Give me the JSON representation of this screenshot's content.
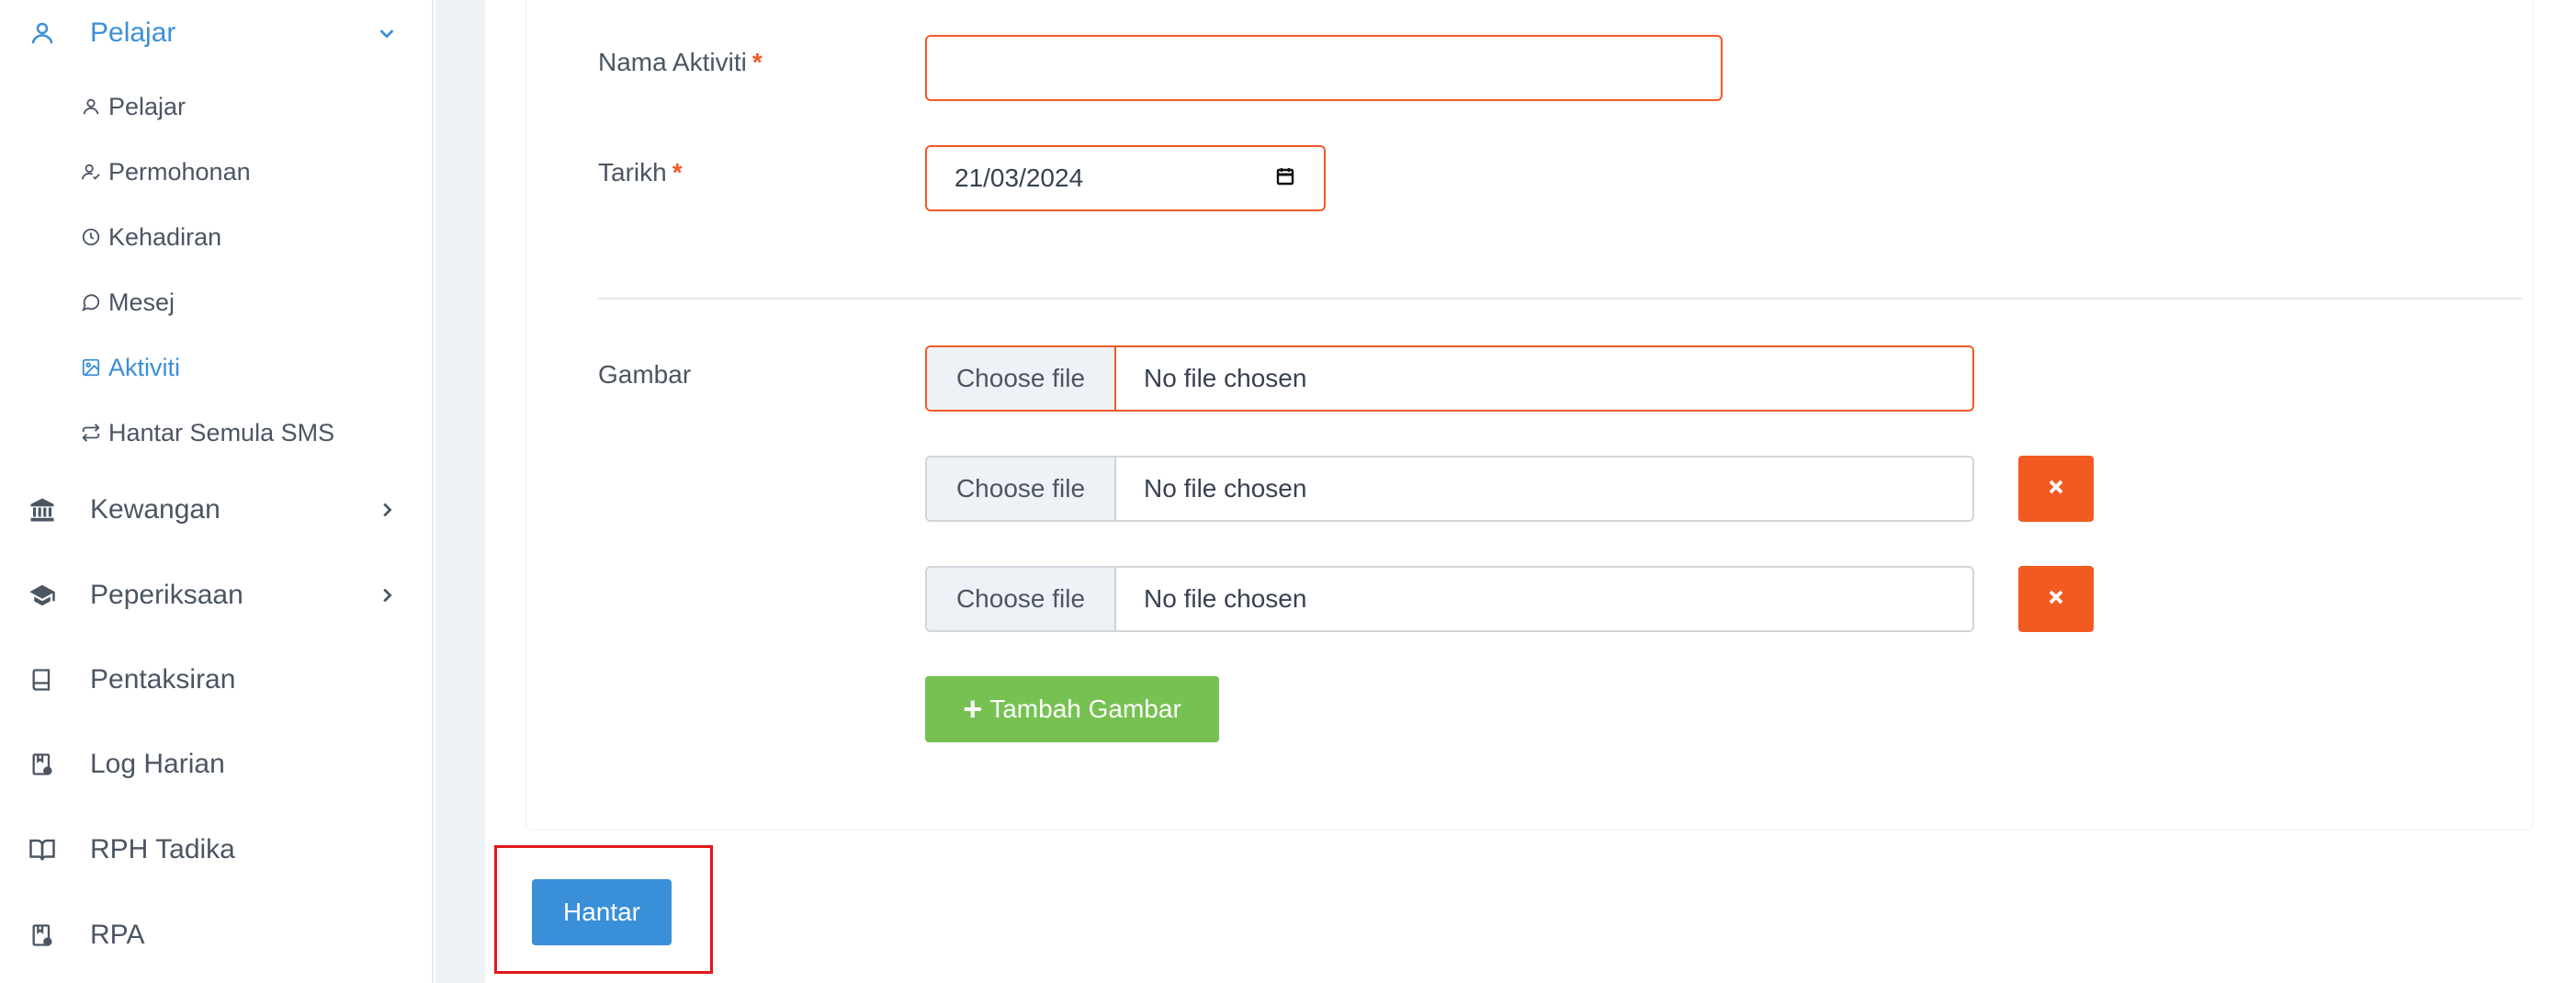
{
  "sidebar": {
    "pelajar": {
      "label": "Pelajar",
      "icon": "user-icon"
    },
    "sub_items": [
      {
        "label": "Pelajar",
        "icon": "user-icon"
      },
      {
        "label": "Permohonan",
        "icon": "user-check-icon"
      },
      {
        "label": "Kehadiran",
        "icon": "clock-icon"
      },
      {
        "label": "Mesej",
        "icon": "message-icon"
      },
      {
        "label": "Aktiviti",
        "icon": "image-icon",
        "active": true
      },
      {
        "label": "Hantar Semula SMS",
        "icon": "repeat-icon"
      }
    ],
    "kewangan": {
      "label": "Kewangan",
      "icon": "bank-icon"
    },
    "peperiksaan": {
      "label": "Peperiksaan",
      "icon": "graduation-cap-icon"
    },
    "pentaksiran": {
      "label": "Pentaksiran",
      "icon": "book-icon"
    },
    "log_harian": {
      "label": "Log Harian",
      "icon": "clipboard-icon"
    },
    "rph_tadika": {
      "label": "RPH Tadika",
      "icon": "open-book-icon"
    },
    "rpa": {
      "label": "RPA",
      "icon": "clipboard-icon"
    }
  },
  "form": {
    "nama_label": "Nama Aktiviti",
    "nama_value": "",
    "tarikh_label": "Tarikh",
    "tarikh_value": "21/03/2024",
    "required_mark": "*",
    "gambar_label": "Gambar",
    "file_inputs": [
      {
        "button": "Choose file",
        "status": "No file chosen"
      },
      {
        "button": "Choose file",
        "status": "No file chosen"
      },
      {
        "button": "Choose file",
        "status": "No file chosen"
      }
    ],
    "add_button": "Tambah Gambar",
    "submit_button": "Hantar"
  },
  "colors": {
    "accent": "#3a8fd9",
    "error_border": "#f05a28",
    "danger": "#f25a22",
    "success": "#76c152",
    "highlight": "#e3161b"
  }
}
